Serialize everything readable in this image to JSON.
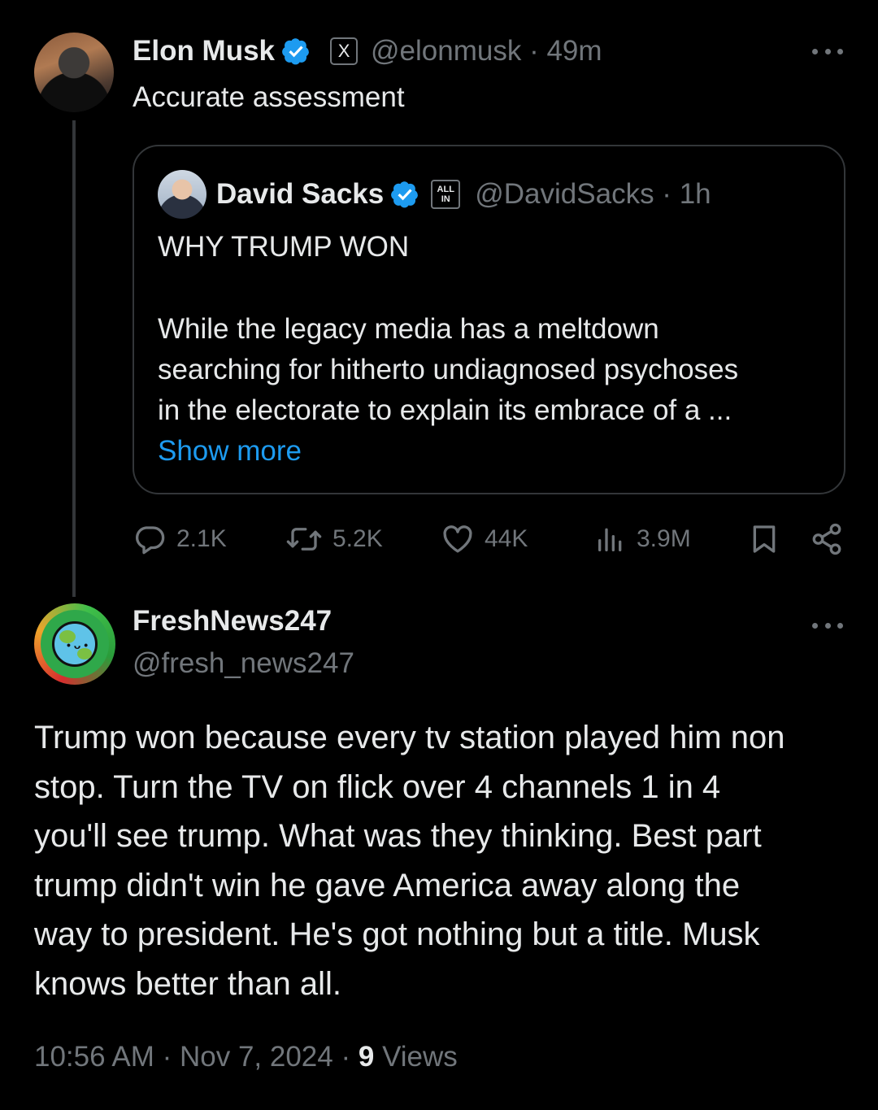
{
  "parent_tweet": {
    "author_name": "Elon Musk",
    "handle": "@elonmusk",
    "time": "49m",
    "affiliation_badge": "X",
    "text": "Accurate assessment",
    "quote": {
      "author_name": "David Sacks",
      "handle": "@DavidSacks",
      "time": "1h",
      "affiliation_badge_line1": "ALL",
      "affiliation_badge_line2": "IN",
      "title": "WHY TRUMP WON",
      "body_lines": [
        "While the legacy media has a meltdown",
        "searching for hitherto undiagnosed psychoses",
        "in the electorate to explain its embrace of a ..."
      ],
      "show_more": "Show more"
    },
    "actions": {
      "replies": "2.1K",
      "reposts": "5.2K",
      "likes": "44K",
      "views": "3.9M"
    }
  },
  "reply_tweet": {
    "author_name": "FreshNews247",
    "handle": "@fresh_news247",
    "text_lines": [
      "Trump won because every tv station played him non",
      "stop. Turn the TV on flick over 4 channels 1 in 4",
      "you'll see trump. What was they thinking. Best part",
      "trump didn't win he gave America away along the",
      "way to president. He's got nothing but a title. Musk",
      "knows better than all."
    ],
    "timestamp": "10:56 AM",
    "date": "Nov 7, 2024",
    "views_count": "9",
    "views_label": "Views"
  },
  "colors": {
    "background": "#000000",
    "text_primary": "#e7e9ea",
    "text_secondary": "#71767b",
    "accent_blue": "#1d9bf0",
    "border": "#333639"
  },
  "icons": {
    "verified": "verified-badge-icon",
    "more": "more-dots-icon",
    "reply": "reply-bubble-icon",
    "repost": "repost-icon",
    "like": "heart-icon",
    "views": "views-bars-icon",
    "bookmark": "bookmark-icon",
    "share": "share-icon"
  }
}
